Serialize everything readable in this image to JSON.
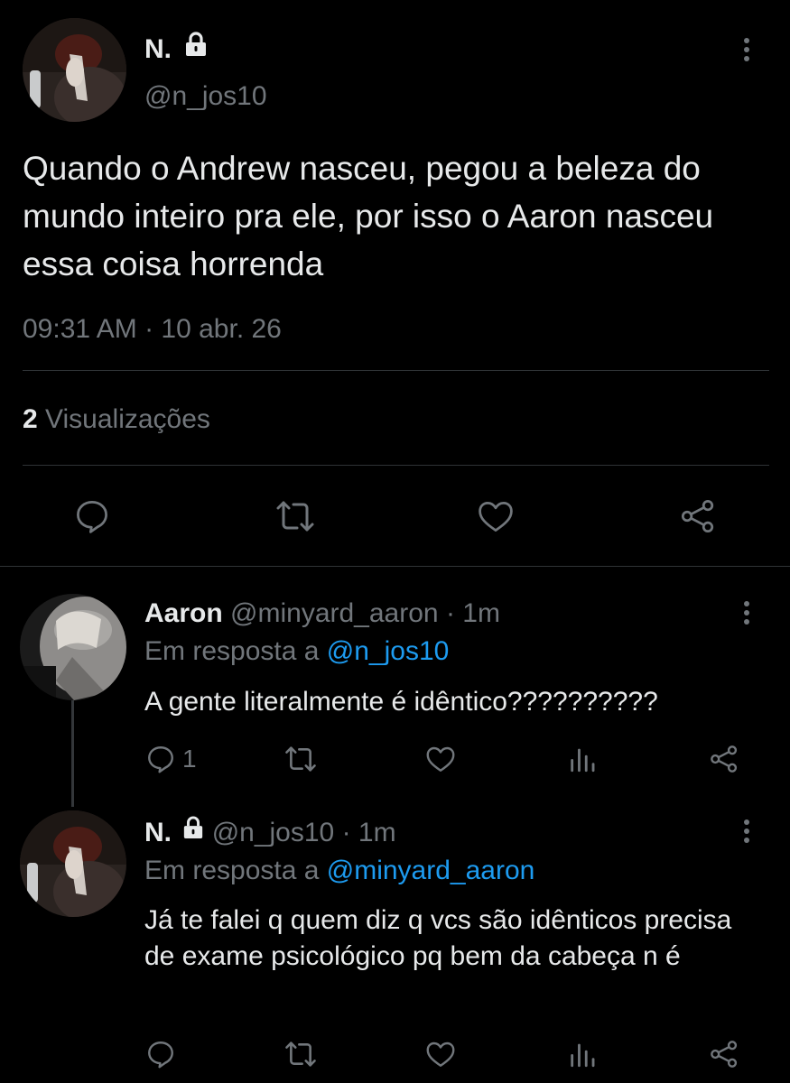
{
  "main_tweet": {
    "display_name": "N.",
    "handle": "@n_jos10",
    "text": "Quando o Andrew nasceu, pegou a beleza do mundo inteiro pra ele, por isso o Aaron nasceu essa coisa horrenda",
    "timestamp": "09:31 AM · 10 abr. 26",
    "views_count": "2",
    "views_label": "Visualizações"
  },
  "reply1": {
    "display_name": "Aaron",
    "handle": "@minyard_aaron",
    "time": "· 1m",
    "reply_prefix": "Em resposta a",
    "reply_to": "@n_jos10",
    "text": "A gente literalmente é idêntico??????????",
    "reply_count": "1"
  },
  "reply2": {
    "display_name": "N.",
    "handle": "@n_jos10",
    "time": "· 1m",
    "reply_prefix": "Em resposta a",
    "reply_to": "@minyard_aaron",
    "text": "Já te falei q quem diz q vcs são idênticos precisa de exame psicológico pq bem da cabeça n é"
  },
  "colors": {
    "background": "#000000",
    "text": "#e7e9ea",
    "muted": "#71767b",
    "link": "#1d9bf0",
    "divider": "#2f3336"
  },
  "icons": {
    "lock": "lock-icon",
    "more": "more-dots-icon",
    "reply": "reply-icon",
    "retweet": "retweet-icon",
    "like": "heart-icon",
    "views": "views-icon",
    "share": "share-icon"
  }
}
